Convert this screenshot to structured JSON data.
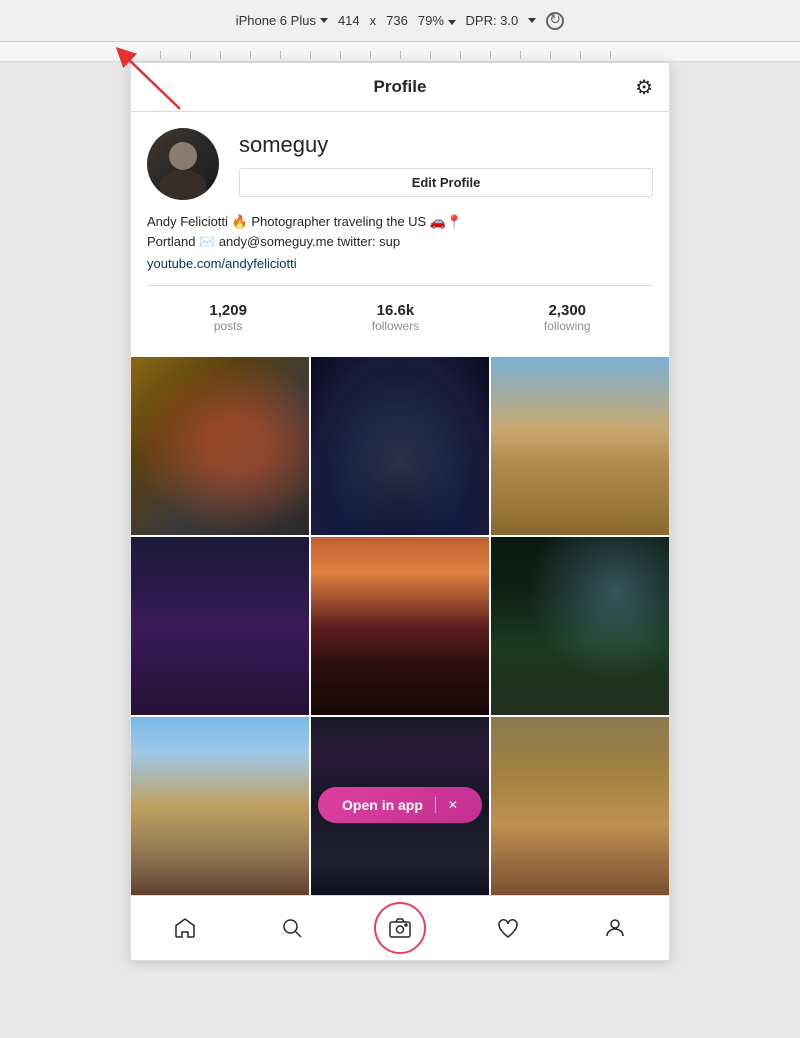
{
  "toolbar": {
    "device_label": "iPhone 6 Plus",
    "width": "414",
    "x_label": "x",
    "height": "736",
    "zoom": "79%",
    "dpr_label": "DPR: 3.0"
  },
  "instagram": {
    "header": {
      "title": "Profile",
      "settings_icon": "gear-icon"
    },
    "profile": {
      "username": "someguy",
      "edit_button_label": "Edit Profile",
      "bio_line1": "Andy Feliciotti 🔥 Photographer traveling the US 🚗📍",
      "bio_line2": "Portland ✉️ andy@someguy.me twitter: sup",
      "bio_link": "youtube.com/andyfeliciotti"
    },
    "stats": [
      {
        "value": "1,209",
        "label": "posts"
      },
      {
        "value": "16.6k",
        "label": "followers"
      },
      {
        "value": "2,300",
        "label": "following"
      }
    ],
    "open_in_app": {
      "label": "Open in app",
      "close_label": "✕"
    },
    "bottom_nav": {
      "items": [
        "home",
        "search",
        "camera",
        "heart",
        "profile"
      ]
    }
  }
}
